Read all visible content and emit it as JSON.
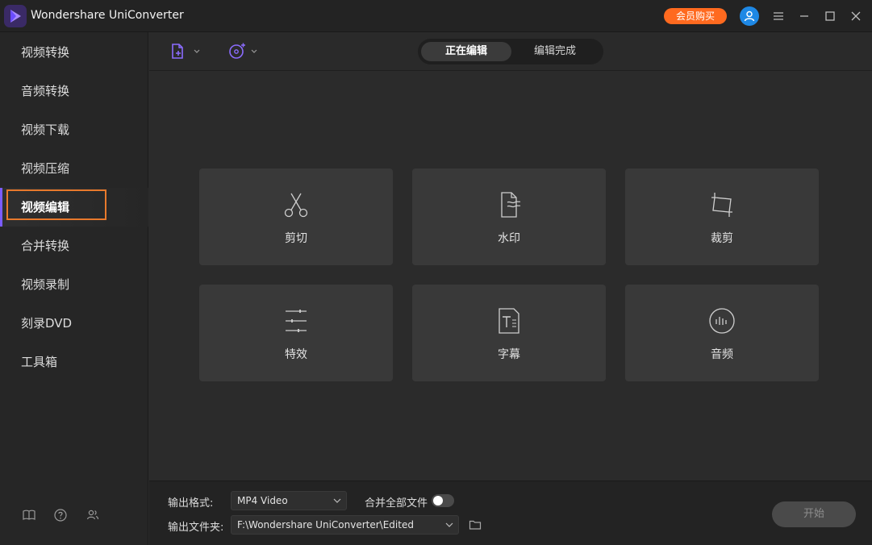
{
  "window": {
    "title": "Wondershare UniConverter",
    "vip_label": "会员购买",
    "vip_color": "#ff6a1f",
    "accent": "#7b5cff"
  },
  "sidebar": {
    "items": [
      {
        "label": "视频转换",
        "active": false
      },
      {
        "label": "音频转换",
        "active": false
      },
      {
        "label": "视频下载",
        "active": false
      },
      {
        "label": "视频压缩",
        "active": false
      },
      {
        "label": "视频编辑",
        "active": true
      },
      {
        "label": "合并转换",
        "active": false
      },
      {
        "label": "视频录制",
        "active": false
      },
      {
        "label": "刻录DVD",
        "active": false
      },
      {
        "label": "工具箱",
        "active": false
      }
    ],
    "bottom_icons": [
      "book-icon",
      "help-icon",
      "users-icon"
    ]
  },
  "toolbar": {
    "tabs": [
      {
        "label": "正在编辑",
        "active": true
      },
      {
        "label": "编辑完成",
        "active": false
      }
    ]
  },
  "tools": [
    {
      "label": "剪切",
      "icon": "scissors-icon"
    },
    {
      "label": "水印",
      "icon": "watermark-icon"
    },
    {
      "label": "裁剪",
      "icon": "crop-icon"
    },
    {
      "label": "特效",
      "icon": "sliders-icon"
    },
    {
      "label": "字幕",
      "icon": "subtitle-icon"
    },
    {
      "label": "音频",
      "icon": "audio-icon"
    }
  ],
  "footer": {
    "format_label": "输出格式:",
    "format_value": "MP4 Video",
    "merge_label": "合并全部文件",
    "merge_enabled": false,
    "folder_label": "输出文件夹:",
    "folder_value": "F:\\Wondershare UniConverter\\Edited",
    "start_label": "开始"
  }
}
